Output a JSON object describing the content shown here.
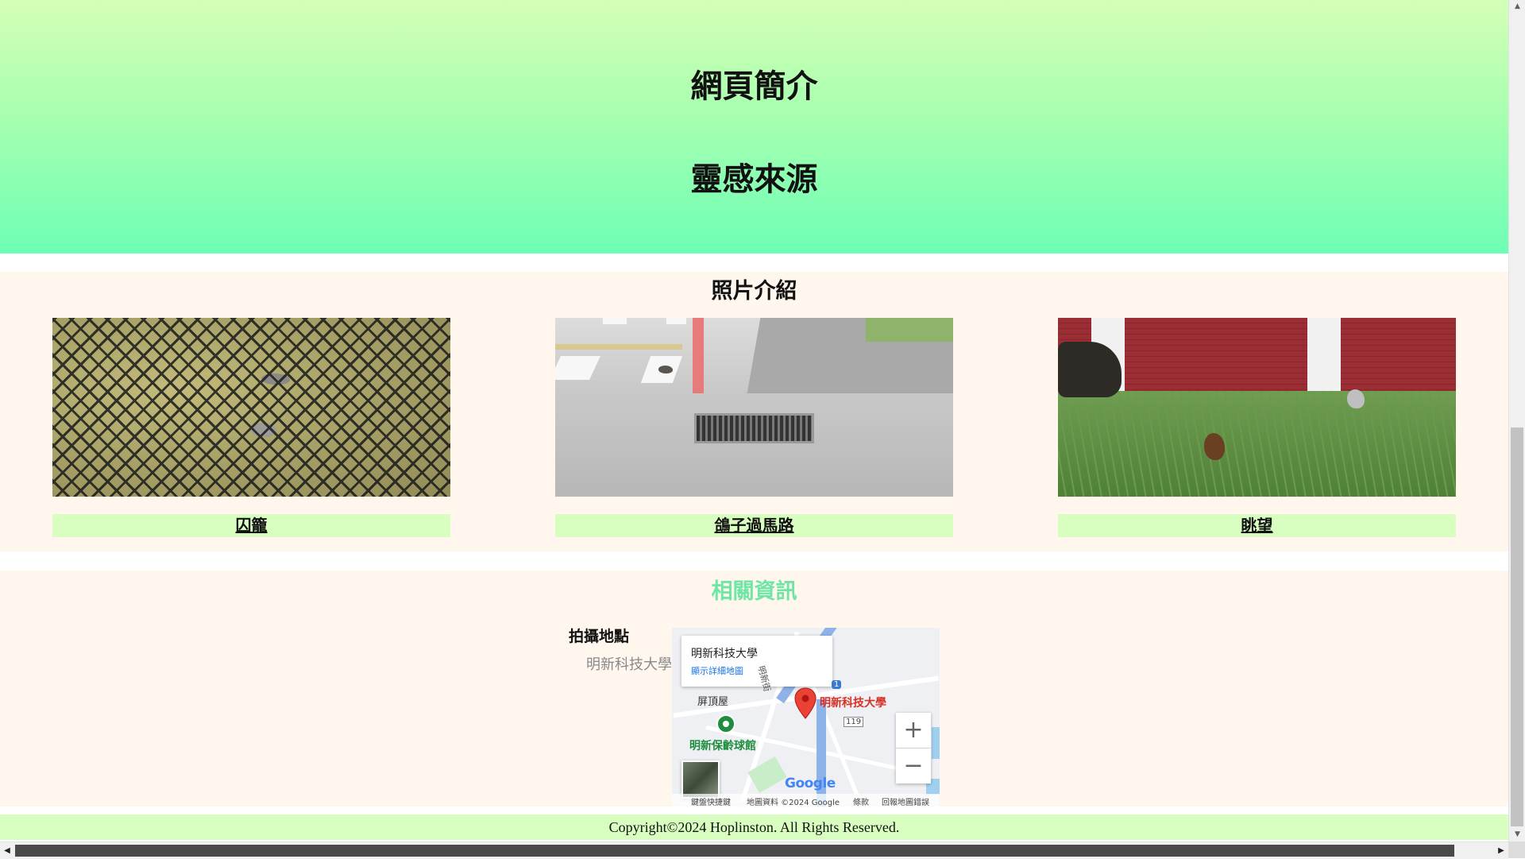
{
  "hero": {
    "title_intro": "網頁簡介",
    "title_inspiration": "靈感來源"
  },
  "photos": {
    "heading": "照片介紹",
    "items": [
      {
        "caption": "囚籠"
      },
      {
        "caption": "鴿子過馬路"
      },
      {
        "caption": "眺望"
      }
    ]
  },
  "info": {
    "heading": "相關資訊",
    "location_label": "拍攝地點",
    "location_value": "明新科技大學",
    "map": {
      "place_name": "明新科技大學",
      "details_link": "顯示詳細地圖",
      "pin_label": "明新科技大學",
      "labels": {
        "shop": "屏頂屋",
        "bowling": "明新保齡球館",
        "street": "明新街",
        "route_badge": "1",
        "road_number": "119"
      },
      "zoom_in": "+",
      "zoom_out": "−",
      "logo": "Google",
      "footer": {
        "shortcuts": "鍵盤快捷鍵",
        "data": "地圖資料 ©2024 Google",
        "terms": "條款",
        "report": "回報地圖錯誤"
      }
    }
  },
  "footer": {
    "copyright": "Copyright©2024 Hoplinston. All Rights Reserved."
  },
  "colors": {
    "hero_top": "#d4ffb6",
    "hero_bottom": "#6dffb5",
    "section_bg": "#fff6ee",
    "caption_bg": "#d8ffbf",
    "info_heading": "#6fe6a6",
    "map_pin": "#d93025"
  }
}
